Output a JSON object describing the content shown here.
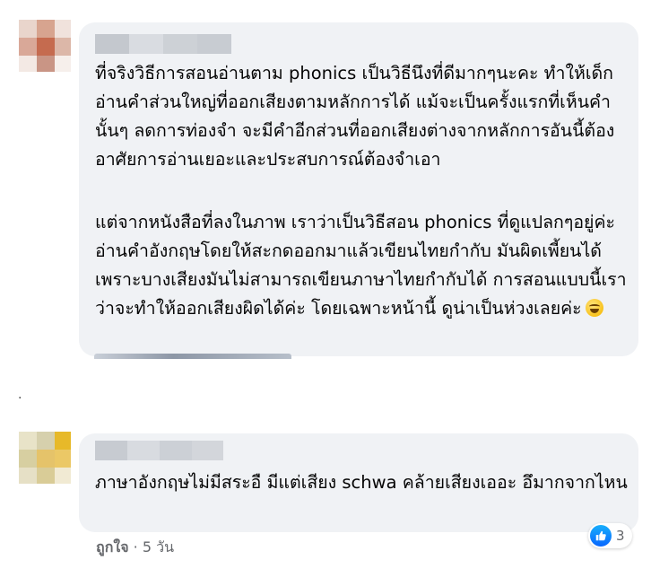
{
  "comments": [
    {
      "paragraphs": [
        "ที่จริงวิธีการสอนอ่านตาม phonics เป็นวิธีนึงที่ดีมากๆนะคะ ทำให้เด็กอ่านคำส่วนใหญ่ที่ออกเสียงตามหลักการได้ แม้จะเป็นครั้งแรกที่เห็นคำนั้นๆ ลดการท่องจำ จะมีคำอีกส่วนที่ออกเสียงต่างจากหลักการอันนี้ต้องอาศัยการอ่านเยอะและประสบการณ์ต้องจำเอา",
        "แต่จากหนังสือที่ลงในภาพ เราว่าเป็นวิธีสอน phonics ที่ดูแปลกๆอยู่ค่ะ อ่านคำอังกฤษโดยให้สะกดออกมาแล้วเขียนไทยกำกับ มันผิดเพี้ยนได้ เพราะบางเสียงมันไม่สามารถเขียนภาษาไทยกำกับได้ การสอนแบบนี้เราว่าจะทำให้ออกเสียงผิดได้ค่ะ โดยเฉพาะหน้านี้ ดูน่าเป็นห่วงเลยค่ะ"
      ],
      "emoji": "grinning-sweat-emoji"
    },
    {
      "paragraphs": [
        "ภาษาอังกฤษไม่มีสระอื มีแต่เสียง schwa คล้ายเสียงเออะ อึมากจากไหน"
      ],
      "like_label": "ถูกใจ",
      "separator": "·",
      "time_ago": "5 วัน",
      "reaction_count": "3",
      "reaction_icon": "thumbs-up-icon"
    }
  ],
  "separator_dot": ".",
  "colors": {
    "bubble": "#f0f2f5",
    "text": "#050505",
    "secondary": "#65676b",
    "like_blue": "#0866ff"
  }
}
